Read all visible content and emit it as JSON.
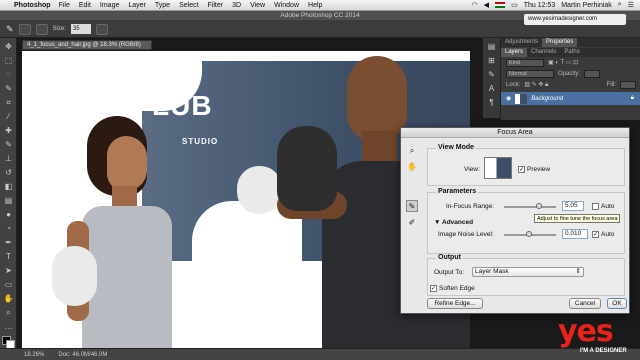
{
  "menubar": {
    "app_name": "Photoshop",
    "items": [
      "File",
      "Edit",
      "Image",
      "Layer",
      "Type",
      "Select",
      "Filter",
      "3D",
      "View",
      "Window",
      "Help"
    ],
    "clock": "Thu 12:53",
    "user": "Martin Perhiniak"
  },
  "window_title": "Adobe Photoshop CC 2014",
  "options": {
    "size_label": "Size:",
    "size_value": "35",
    "workspace": "www.yesimadesigner.com"
  },
  "document": {
    "tab": "4_1_focus_and_hair.jpg @ 18.3% (RGB/8)",
    "logo_text": "LUB",
    "logo_sub": "STUDIO"
  },
  "panels": {
    "top_tabs": [
      "Adjustments",
      "Properties"
    ],
    "tabs": [
      "Layers",
      "Channels",
      "Paths"
    ],
    "kind_label": "Kind",
    "blend_mode": "Normal",
    "opacity_label": "Opacity:",
    "lock_label": "Lock:",
    "fill_label": "Fill:",
    "layer_name": "Background"
  },
  "dialog": {
    "title": "Focus Area",
    "view_mode_title": "View Mode",
    "view_label": "View:",
    "preview_label": "Preview",
    "parameters_title": "Parameters",
    "range_label": "In-Focus Range:",
    "range_value": "5.05",
    "auto_label": "Auto",
    "tooltip": "Adjust to fine tune the focus area",
    "advanced_title": "Advanced",
    "noise_label": "Image Noise Level:",
    "noise_value": "0.010",
    "noise_auto_label": "Auto",
    "output_title": "Output",
    "output_to_label": "Output To:",
    "output_to_value": "Layer Mask",
    "soften_label": "Soften Edge",
    "refine_button": "Refine Edge...",
    "cancel_button": "Cancel",
    "ok_button": "OK",
    "preview_checked": true,
    "range_auto_checked": false,
    "noise_auto_checked": true,
    "soften_checked": true
  },
  "status": {
    "zoom": "18.26%",
    "doc": "Doc: 46.0M/46.0M"
  },
  "watermark": {
    "brand": "yes",
    "sub": "I'M A DESIGNER"
  }
}
